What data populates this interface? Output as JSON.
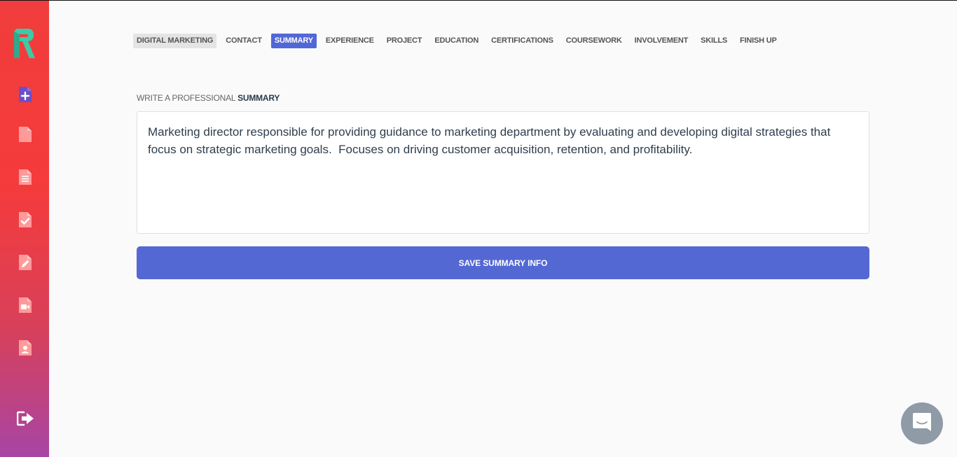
{
  "colors": {
    "sidebar_top": "#f13d3d",
    "sidebar_bottom": "#a745a5",
    "accent": "#5468d4",
    "logo": "#3ec9a7",
    "chat": "#8f9ba6"
  },
  "sidebar": {
    "logo_icon": "r-logo-icon",
    "items": [
      {
        "icon": "new-document-icon"
      },
      {
        "icon": "document-icon"
      },
      {
        "icon": "document-lines-icon"
      },
      {
        "icon": "document-check-icon"
      },
      {
        "icon": "document-edit-icon"
      },
      {
        "icon": "document-video-icon"
      },
      {
        "icon": "document-person-icon"
      }
    ],
    "logout_icon": "sign-out-icon"
  },
  "tabs": [
    {
      "label": "DIGITAL MARKETING",
      "state": "visited"
    },
    {
      "label": "CONTACT",
      "state": "normal"
    },
    {
      "label": "SUMMARY",
      "state": "active"
    },
    {
      "label": "EXPERIENCE",
      "state": "normal"
    },
    {
      "label": "PROJECT",
      "state": "normal"
    },
    {
      "label": "EDUCATION",
      "state": "normal"
    },
    {
      "label": "CERTIFICATIONS",
      "state": "normal"
    },
    {
      "label": "COURSEWORK",
      "state": "normal"
    },
    {
      "label": "INVOLVEMENT",
      "state": "normal"
    },
    {
      "label": "SKILLS",
      "state": "normal"
    },
    {
      "label": "FINISH UP",
      "state": "normal"
    }
  ],
  "heading": {
    "prefix": "WRITE A PROFESSIONAL ",
    "emphasis": "SUMMARY"
  },
  "summary": {
    "value": "Marketing director responsible for providing guidance to marketing department by evaluating and developing digital strategies that focus on strategic marketing goals.  Focuses on driving customer acquisition, retention, and profitability."
  },
  "save_button": {
    "label": "SAVE SUMMARY INFO"
  },
  "chat": {
    "icon": "chat-bubble-icon"
  }
}
